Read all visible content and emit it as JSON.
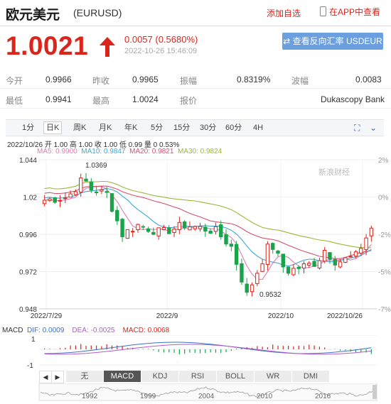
{
  "header": {
    "name": "欧元美元",
    "code": "(EURUSD)",
    "add_watchlist": "添加自选",
    "app_view": "在APP中查看"
  },
  "quote": {
    "price": "1.0021",
    "change": "0.0057 (0.5680%)",
    "time": "2022-10-26 15:46:09",
    "reverse_button": "⇄ 查看反向汇率 USDEUR",
    "colors": {
      "up": "#d9251c",
      "down": "#1aa34a"
    }
  },
  "stats": {
    "row1": [
      {
        "label": "今开",
        "value": "0.9966"
      },
      {
        "label": "昨收",
        "value": "0.9965"
      },
      {
        "label": "振幅",
        "value": "0.8319%"
      },
      {
        "label": "波幅",
        "value": "0.0083"
      }
    ],
    "row2": [
      {
        "label": "最低",
        "value": "0.9941"
      },
      {
        "label": "最高",
        "value": "1.0024"
      },
      {
        "label": "报价",
        "value": "Dukascopy Bank"
      }
    ]
  },
  "period_tabs": [
    "1分",
    "日K",
    "周K",
    "月K",
    "年K",
    "5分",
    "15分",
    "30分",
    "60分",
    "4H"
  ],
  "active_period": "日K",
  "chart_info": {
    "line": "2022/10/26 开 1.00 高 1.00 收 1.00 低 0.99 量 0 0.53%",
    "ma5": "MA5: 0.9900",
    "ma10": "MA10: 0.9847",
    "ma20": "MA20: 0.9821",
    "ma30": "MA30: 0.9824",
    "watermark": "新浪财经"
  },
  "macd_info": {
    "macd": "MACD",
    "dif": "DIF: 0.0009",
    "dea": "DEA: -0.0025",
    "value": "MACD: 0.0068"
  },
  "indicator_tabs": [
    "无",
    "MACD",
    "KDJ",
    "RSI",
    "BOLL",
    "WR",
    "DMI"
  ],
  "active_indicator": "MACD",
  "nav": {
    "prev": "◀",
    "next": "▶"
  },
  "chart_data": {
    "type": "candlestick",
    "y_labels": [
      "1.044",
      "1.02",
      "0.996",
      "0.972",
      "0.948"
    ],
    "pct_labels": [
      "2%",
      "0%",
      "-2%",
      "-5%",
      "-7%"
    ],
    "x_labels": [
      "2022/7/29",
      "2022/9",
      "2022/10",
      "2022/10/26"
    ],
    "ylim": [
      0.948,
      1.044
    ],
    "annotations": {
      "high": "1.0369",
      "low": "0.9532"
    },
    "macd_axis": [
      "1",
      "-1"
    ],
    "overview_years": [
      "1992",
      "1999",
      "2004",
      "2010",
      "2016"
    ],
    "colors": {
      "ma5": "#e07ab5",
      "ma10": "#3aa6d8",
      "ma20": "#d94f6e",
      "ma30": "#9ab93a",
      "up": "#d9251c",
      "down": "#1aa34a"
    }
  }
}
